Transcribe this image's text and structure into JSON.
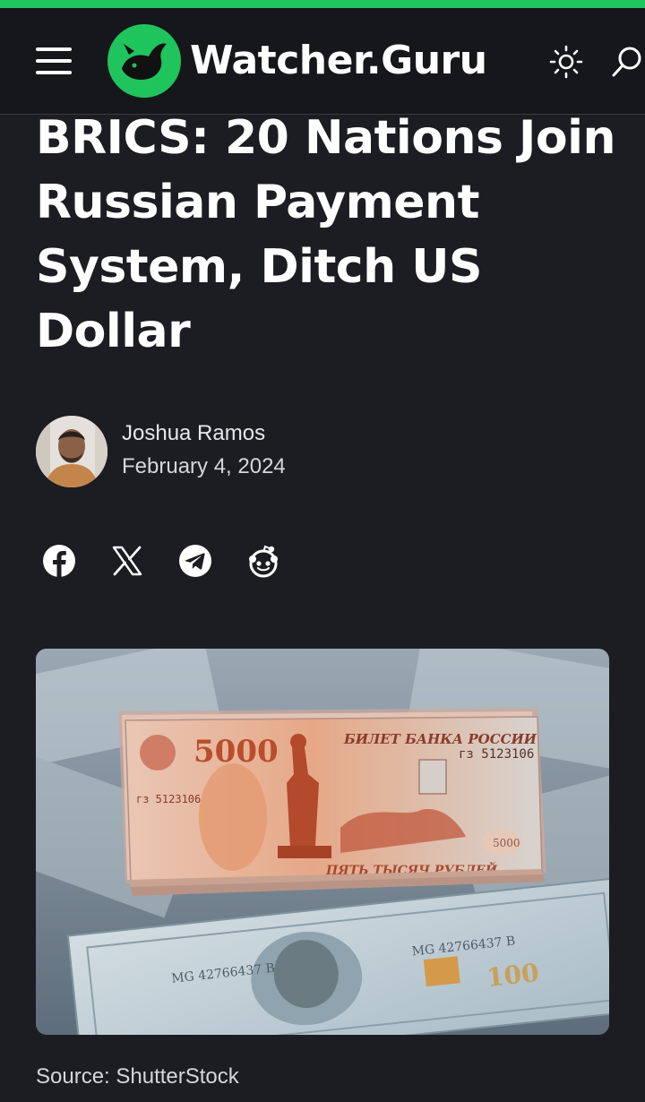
{
  "site": {
    "name": "Watcher.Guru"
  },
  "header": {
    "menu_icon": "hamburger-menu-icon",
    "theme_icon": "sun-icon",
    "search_icon": "search-icon"
  },
  "article": {
    "title": "BRICS: 20 Nations Join Russian Payment System, Ditch US Dollar",
    "author": "Joshua Ramos",
    "date": "February 4, 2024",
    "share": [
      {
        "icon": "facebook-icon"
      },
      {
        "icon": "x-icon"
      },
      {
        "icon": "telegram-icon"
      },
      {
        "icon": "reddit-icon"
      }
    ],
    "image": {
      "banknote_denomination": "5000",
      "banknote_header": "БИЛЕТ БАНКА РОССИИ",
      "banknote_serial": "гз 5123106",
      "banknote_words": "ПЯТЬ ТЫСЯЧ РУБЛЕЙ",
      "dollar_denomination": "100",
      "dollar_serial": "MG 42766437 B"
    },
    "image_source": "Source: ShutterStock"
  },
  "colors": {
    "accent": "#1fc45c",
    "background": "#1c1d22",
    "header": "#16171b"
  }
}
